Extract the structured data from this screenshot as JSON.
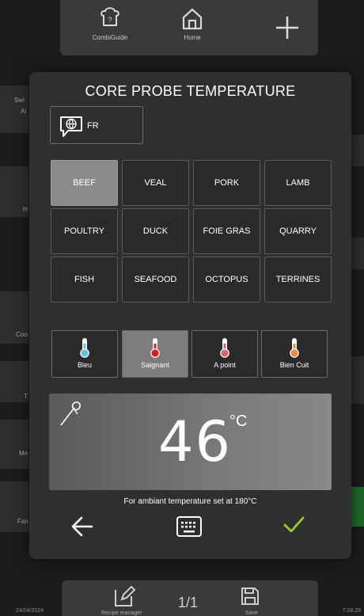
{
  "app": {
    "top_nav": {
      "combiguide_label": "CombiGuide",
      "home_label": "Home"
    },
    "left_labels": [
      "Swi",
      "Al",
      "H",
      "Coo",
      "T",
      "Me",
      "Fan"
    ],
    "bottom": {
      "recipe_label": "Recipe manager",
      "page_indicator": "1/1",
      "save_label": "Save",
      "date": "24/04/2024",
      "time": "7:28:28"
    }
  },
  "modal": {
    "title": "CORE PROBE TEMPERATURE",
    "language_code": "FR",
    "categories": [
      {
        "label": "BEEF",
        "selected": true
      },
      {
        "label": "VEAL",
        "selected": false
      },
      {
        "label": "PORK",
        "selected": false
      },
      {
        "label": "LAMB",
        "selected": false
      },
      {
        "label": "POULTRY",
        "selected": false
      },
      {
        "label": "DUCK",
        "selected": false
      },
      {
        "label": "FOIE GRAS",
        "selected": false
      },
      {
        "label": "QUARRY",
        "selected": false
      },
      {
        "label": "FISH",
        "selected": false
      },
      {
        "label": "SEAFOOD",
        "selected": false
      },
      {
        "label": "OCTOPUS",
        "selected": false
      },
      {
        "label": "TERRINES",
        "selected": false
      }
    ],
    "doneness": [
      {
        "label": "Bleu",
        "color": "#5ec7e0",
        "selected": false
      },
      {
        "label": "Saignant",
        "color": "#d81e1e",
        "selected": true
      },
      {
        "label": "A point",
        "color": "#e0606a",
        "selected": false
      },
      {
        "label": "Bien Cuit",
        "color": "#f08a3a",
        "selected": false
      }
    ],
    "temperature": "46",
    "unit": "°C",
    "ambient_note": "For ambiant temperature set at 180°C"
  },
  "colors": {
    "confirm_check": "#9ccc2a",
    "accent_red": "#d81e1e"
  },
  "icons": [
    "combiguide-icon",
    "home-icon",
    "plus-icon",
    "globe-speech-icon",
    "thermometer-icon",
    "probe-icon",
    "back-arrow-icon",
    "keyboard-icon",
    "check-icon",
    "edit-icon",
    "save-icon"
  ]
}
